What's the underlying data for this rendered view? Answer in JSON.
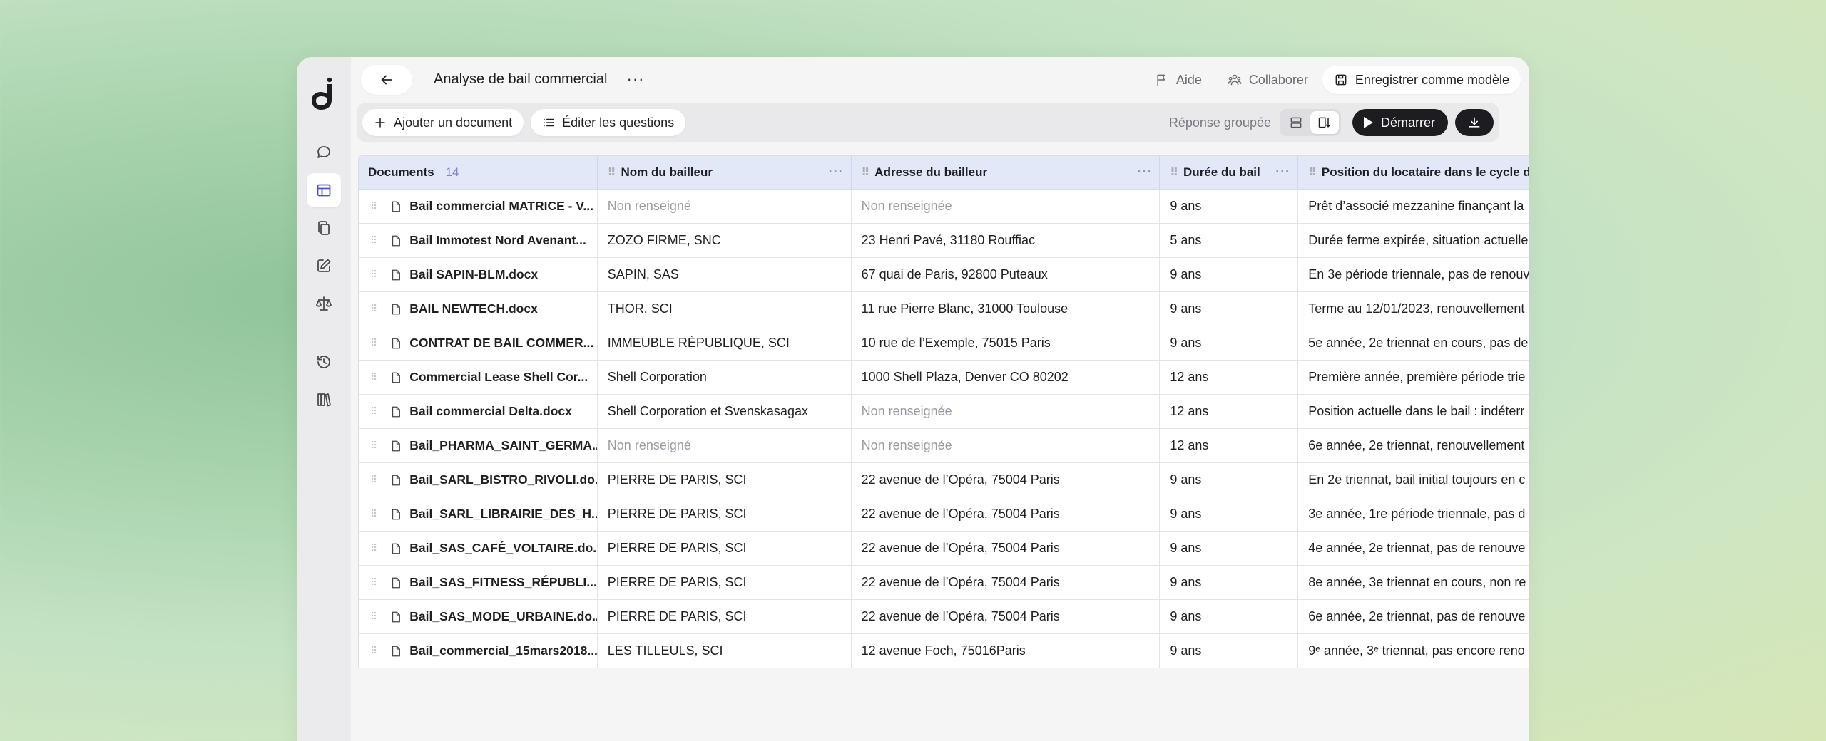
{
  "header": {
    "title": "Analyse de bail commercial",
    "more": "···",
    "help_label": "Aide",
    "collab_label": "Collaborer",
    "save_template_label": "Enregistrer comme modèle"
  },
  "toolbar": {
    "add_document_label": "Ajouter un document",
    "edit_questions_label": "Éditer les questions",
    "grouped_label": "Réponse groupée",
    "start_label": "Démarrer"
  },
  "table": {
    "columns": [
      {
        "label": "Documents",
        "count": "14"
      },
      {
        "label": "Nom du bailleur"
      },
      {
        "label": "Adresse du bailleur"
      },
      {
        "label": "Durée du bail"
      },
      {
        "label": "Position du locataire dans le cycle du"
      }
    ],
    "rows": [
      {
        "doc": "Bail commercial MATRICE - V...",
        "name": "Non renseigné",
        "address": "Non renseignée",
        "duration": "9 ans",
        "position": "Prêt d’associé mezzanine finançant la"
      },
      {
        "doc": "Bail Immotest Nord Avenant...",
        "name": "ZOZO FIRME, SNC",
        "address": "23 Henri Pavé, 31180 Rouffiac",
        "duration": "5 ans",
        "position": "Durée ferme expirée, situation actuelle"
      },
      {
        "doc": "Bail SAPIN-BLM.docx",
        "name": "SAPIN, SAS",
        "address": "67 quai de Paris, 92800 Puteaux",
        "duration": "9 ans",
        "position": "En 3e période triennale, pas de renouv"
      },
      {
        "doc": "BAIL NEWTECH.docx",
        "name": "THOR, SCI",
        "address": "11 rue Pierre Blanc, 31000 Toulouse",
        "duration": "9 ans",
        "position": "Terme au 12/01/2023, renouvellement"
      },
      {
        "doc": "CONTRAT DE BAIL COMMER...",
        "name": "IMMEUBLE RÉPUBLIQUE, SCI",
        "address": "10 rue de l’Exemple, 75015 Paris",
        "duration": "9 ans",
        "position": "5e année, 2e triennat en cours, pas de"
      },
      {
        "doc": "Commercial Lease Shell Cor...",
        "name": "Shell Corporation",
        "address": "1000 Shell Plaza, Denver CO 80202",
        "duration": "12 ans",
        "position": "Première année, première période trie"
      },
      {
        "doc": "Bail commercial Delta.docx",
        "name": "Shell Corporation et Svenskasagax",
        "address": "Non renseignée",
        "duration": "12 ans",
        "position": "Position actuelle dans le bail : indéterr"
      },
      {
        "doc": "Bail_PHARMA_SAINT_GERMA...",
        "name": "Non renseigné",
        "address": "Non renseignée",
        "duration": "12 ans",
        "position": "6e année, 2e triennat, renouvellement"
      },
      {
        "doc": "Bail_SARL_BISTRO_RIVOLI.do...",
        "name": "PIERRE DE PARIS, SCI",
        "address": "22 avenue de l’Opéra, 75004 Paris",
        "duration": "9 ans",
        "position": "En 2e triennat, bail initial toujours en c"
      },
      {
        "doc": "Bail_SARL_LIBRAIRIE_DES_H...",
        "name": "PIERRE DE PARIS, SCI",
        "address": "22 avenue de l’Opéra, 75004 Paris",
        "duration": "9 ans",
        "position": "3e année, 1re période triennale, pas d"
      },
      {
        "doc": "Bail_SAS_CAFÉ_VOLTAIRE.do...",
        "name": "PIERRE DE PARIS, SCI",
        "address": "22 avenue de l’Opéra, 75004 Paris",
        "duration": "9 ans",
        "position": "4e année, 2e triennat, pas de renouve"
      },
      {
        "doc": "Bail_SAS_FITNESS_RÉPUBLI...",
        "name": "PIERRE DE PARIS, SCI",
        "address": "22 avenue de l’Opéra, 75004 Paris",
        "duration": "9 ans",
        "position": "8e année, 3e triennat en cours, non re"
      },
      {
        "doc": "Bail_SAS_MODE_URBAINE.do...",
        "name": "PIERRE DE PARIS, SCI",
        "address": "22 avenue de l’Opéra, 75004 Paris",
        "duration": "9 ans",
        "position": "6e année, 2e triennat, pas de renouve"
      },
      {
        "doc": "Bail_commercial_15mars2018...",
        "name": "LES TILLEULS, SCI",
        "address": "12 avenue Foch, 75016Paris",
        "duration": "9 ans",
        "position": "9ᵉ année, 3ᵉ triennat, pas encore reno"
      }
    ]
  },
  "icons": {
    "logo": "logo-icon",
    "rail": [
      "chat-icon",
      "table-icon",
      "copy-icon",
      "edit-icon",
      "scale-icon",
      "history-icon",
      "library-icon"
    ]
  },
  "colors": {
    "accent": "#4b55c8",
    "header_bg": "#e3e8f9",
    "muted_text": "#9a9aa3",
    "dark_button": "#1c1c21"
  }
}
